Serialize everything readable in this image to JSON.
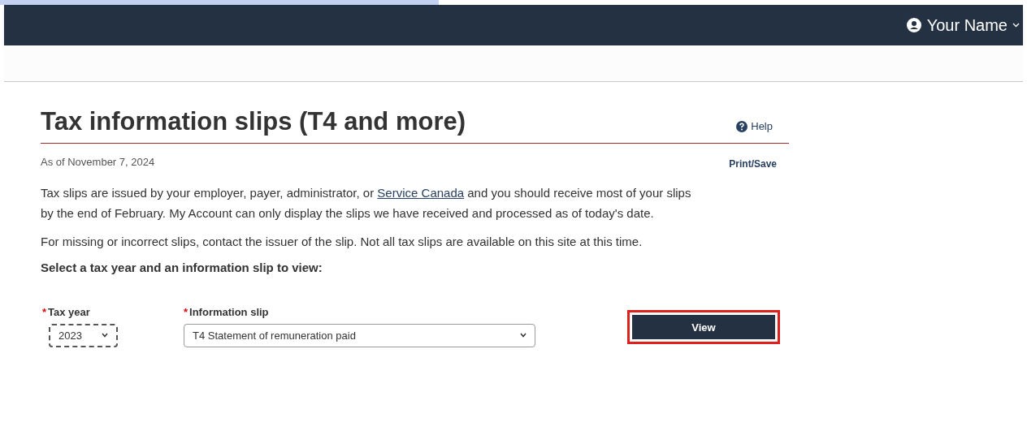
{
  "header": {
    "user_name": "Your Name"
  },
  "page": {
    "title": "Tax information slips (T4 and more)",
    "help_link": "Help",
    "as_of": "As of November 7, 2024",
    "print_link": "Print/Save",
    "paragraphs": [
      {
        "parts": [
          {
            "text": "Tax slips are issued by your employer, payer, administrator, or "
          },
          {
            "text": "Service Canada",
            "link": true
          },
          {
            "text": " and you should receive most of your slips by the end of February. My Account can only display the slips we have received and processed as of today's date."
          }
        ]
      },
      {
        "parts": [
          {
            "text": "For missing or incorrect slips, contact the issuer of the slip. Not all tax slips are available on this site at this time."
          }
        ]
      }
    ],
    "instruction": "Select a tax year and an information slip to view:"
  },
  "form": {
    "fields": [
      {
        "label": "Tax year",
        "required_mark": "*",
        "value": "2023",
        "focused": true
      },
      {
        "label": "Information slip",
        "required_mark": "*",
        "value": "T4 Statement of remuneration paid",
        "focused": false
      }
    ],
    "view_button": {
      "label": "View",
      "highlighted": true
    }
  }
}
